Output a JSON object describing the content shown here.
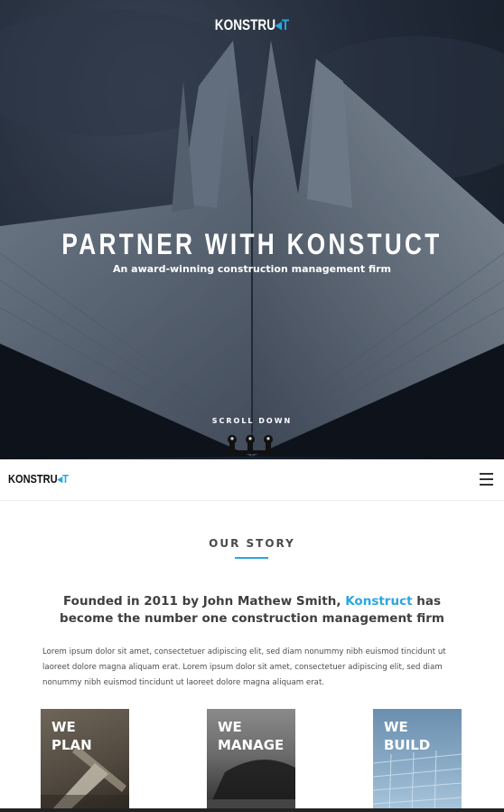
{
  "hero": {
    "logo_text": "KONSTRU",
    "logo_mark": "◂T",
    "title": "PARTNER WITH KONSTUCT",
    "subtitle": "An award-winning construction management firm",
    "scroll_label": "SCROLL DOWN"
  },
  "navbar": {
    "logo_text": "KONSTRU",
    "logo_mark": "◂T",
    "menu_icon": "hamburger-icon"
  },
  "story": {
    "title": "OUR STORY",
    "headline_part1": "Founded in 2011 by John Mathew Smith, ",
    "headline_accent": "Konstruct",
    "headline_part2": " has become the number one construction management firm",
    "body": "Lorem ipsum dolor sit amet, consectetuer adipiscing elit, sed diam nonummy nibh euismod tincidunt ut laoreet dolore magna aliquam erat. Lorem ipsum dolor sit amet, consectetuer adipiscing elit, sed diam nonummy nibh euismod tincidunt ut laoreet dolore magna aliquam erat."
  },
  "cards": [
    {
      "line1": "WE",
      "line2": "PLAN"
    },
    {
      "line1": "WE",
      "line2": "MANAGE"
    },
    {
      "line1": "WE",
      "line2": "BUILD"
    }
  ],
  "colors": {
    "accent": "#2aa6e0",
    "text_dark": "#3f3f3f"
  }
}
